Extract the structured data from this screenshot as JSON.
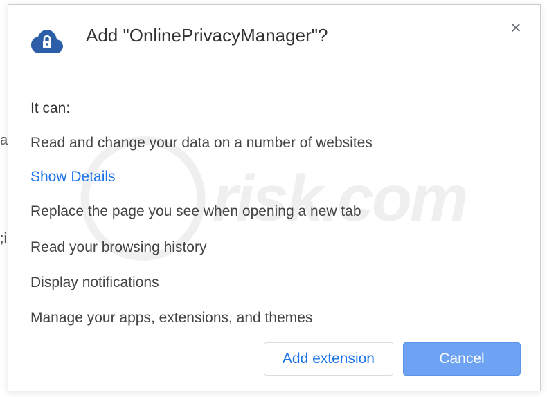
{
  "dialog": {
    "title": "Add \"OnlinePrivacyManager\"?",
    "it_can_label": "It can:",
    "permissions": [
      "Read and change your data on a number of websites",
      "Replace the page you see when opening a new tab",
      "Read your browsing history",
      "Display notifications",
      "Manage your apps, extensions, and themes"
    ],
    "show_details_label": "Show Details",
    "buttons": {
      "add_label": "Add extension",
      "cancel_label": "Cancel"
    }
  },
  "watermark": {
    "text": "risk.com"
  }
}
